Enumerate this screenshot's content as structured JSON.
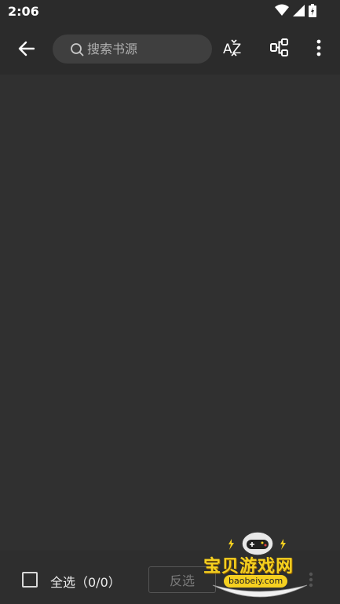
{
  "status_bar": {
    "time": "2:06"
  },
  "toolbar": {
    "search_placeholder": "搜索书源",
    "sort_label": "AZ"
  },
  "bottom_bar": {
    "select_all_label": "全选（0/0）",
    "invert_label": "反选"
  },
  "watermark": {
    "title": "宝贝游戏网",
    "url": "baobeiy.com"
  },
  "colors": {
    "background": "#303030",
    "toolbar": "#2b2b2b",
    "search_bg": "#3f3f3f",
    "watermark_yellow": "#f5d020"
  }
}
